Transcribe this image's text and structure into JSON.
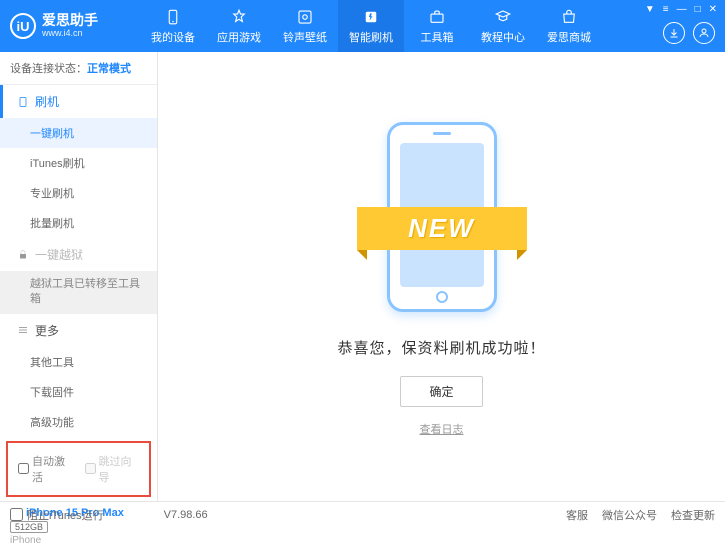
{
  "header": {
    "logo_mark": "iU",
    "app_name": "爱思助手",
    "url": "www.i4.cn",
    "nav": [
      {
        "label": "我的设备",
        "icon": "device"
      },
      {
        "label": "应用游戏",
        "icon": "app"
      },
      {
        "label": "铃声壁纸",
        "icon": "ringtone"
      },
      {
        "label": "智能刷机",
        "icon": "flash"
      },
      {
        "label": "工具箱",
        "icon": "toolbox"
      },
      {
        "label": "教程中心",
        "icon": "tutorial"
      },
      {
        "label": "爱思商城",
        "icon": "store"
      }
    ],
    "active_nav_index": 3
  },
  "sidebar": {
    "status_label": "设备连接状态：",
    "status_value": "正常模式",
    "groups": [
      {
        "title": "刷机",
        "icon": "flash",
        "active": true,
        "items": [
          {
            "label": "一键刷机",
            "active": true
          },
          {
            "label": "iTunes刷机"
          },
          {
            "label": "专业刷机"
          },
          {
            "label": "批量刷机"
          }
        ]
      },
      {
        "title": "一键越狱",
        "icon": "lock",
        "locked": true,
        "items": [
          {
            "label": "越狱工具已转移至工具箱",
            "gray": true
          }
        ]
      },
      {
        "title": "更多",
        "icon": "more",
        "items": [
          {
            "label": "其他工具"
          },
          {
            "label": "下载固件"
          },
          {
            "label": "高级功能"
          }
        ]
      }
    ],
    "checkboxes": {
      "auto_activate": "自动激活",
      "skip_guide": "跳过向导"
    },
    "device": {
      "name": "iPhone 15 Pro Max",
      "storage": "512GB",
      "type": "iPhone"
    }
  },
  "main": {
    "new_badge": "NEW",
    "success_message": "恭喜您，保资料刷机成功啦！",
    "ok_button": "确定",
    "log_link": "查看日志"
  },
  "footer": {
    "block_itunes": "阻止iTunes运行",
    "version": "V7.98.66",
    "links": [
      "客服",
      "微信公众号",
      "检查更新"
    ]
  }
}
